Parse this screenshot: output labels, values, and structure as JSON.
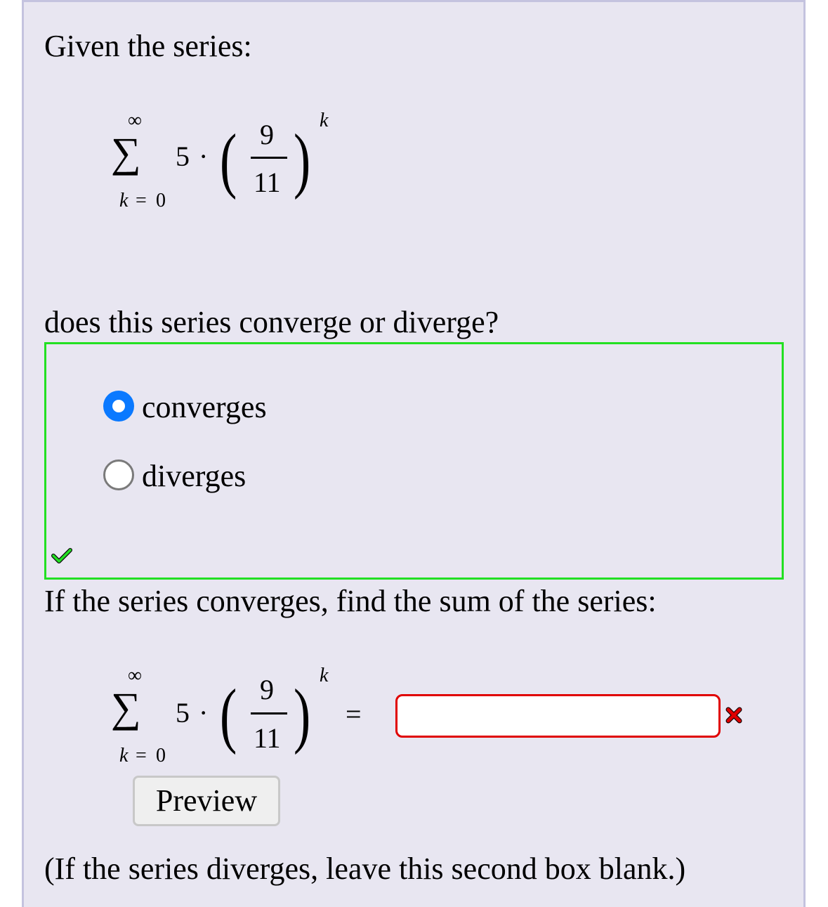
{
  "question": {
    "intro": "Given the series:",
    "converge_prompt": "does this series converge or diverge?",
    "sum_prompt": "If the series converges, find the sum of the series:",
    "footnote": "(If the series diverges, leave this second box blank.)"
  },
  "series": {
    "upper_limit": "∞",
    "lower_limit_var": "k",
    "lower_limit_eq": "=",
    "lower_limit_val": "0",
    "coefficient": "5",
    "dot": "·",
    "numerator": "9",
    "denominator": "11",
    "exponent": "k",
    "equals": "="
  },
  "choices": [
    {
      "label": "converges",
      "selected": true
    },
    {
      "label": "diverges",
      "selected": false
    }
  ],
  "status": {
    "choice_correct_icon": "check-icon",
    "choice_color": "#22e022",
    "sum_incorrect_icon": "x-icon",
    "sum_color": "#e00000"
  },
  "sum_input": {
    "value": ""
  },
  "preview_button": {
    "label": "Preview"
  }
}
